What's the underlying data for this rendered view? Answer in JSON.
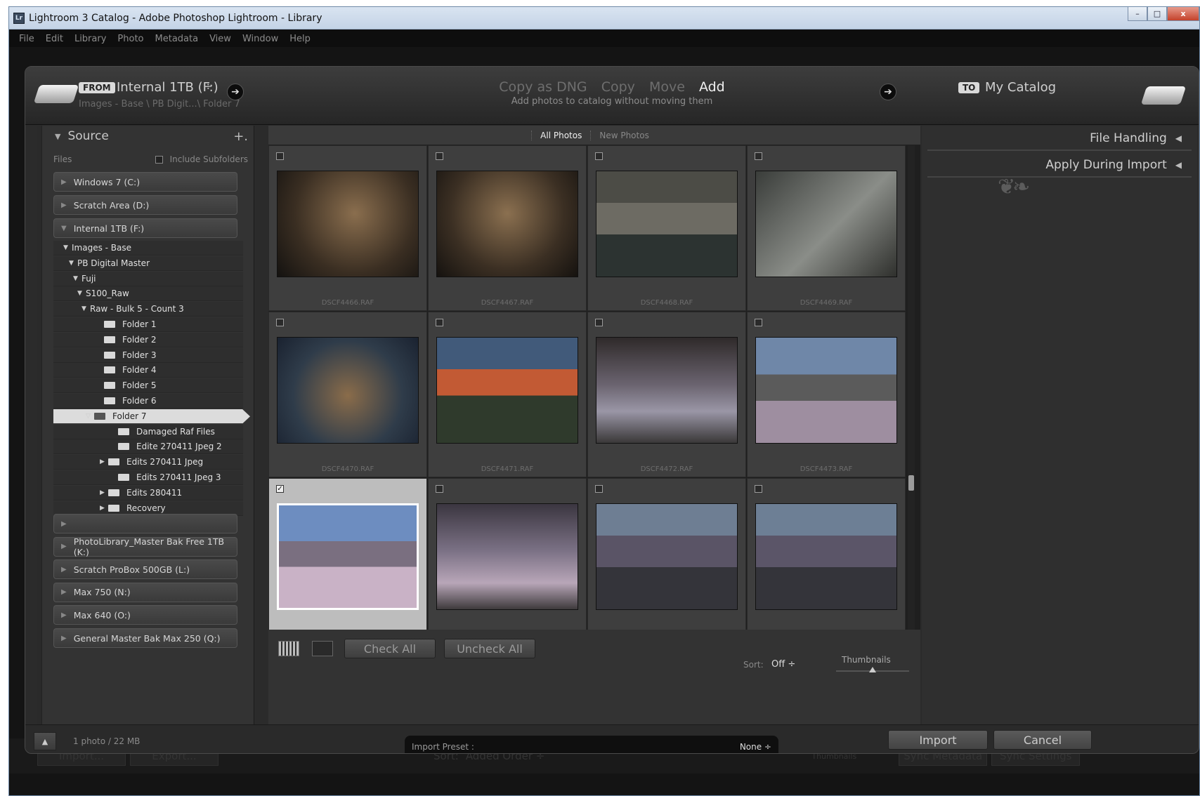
{
  "window": {
    "title": "Lightroom 3 Catalog - Adobe Photoshop Lightroom - Library",
    "app_icon": "Lr",
    "controls": {
      "minimize": "–",
      "maximize": "□",
      "close": "x"
    }
  },
  "menubar": [
    "File",
    "Edit",
    "Library",
    "Photo",
    "Metadata",
    "View",
    "Window",
    "Help"
  ],
  "header": {
    "from_badge": "FROM",
    "source_name": "Internal 1TB (F:)",
    "source_dropdown": "÷",
    "source_path": "Images - Base \\ PB Digit...\\ Folder 7",
    "modes": [
      "Copy as DNG",
      "Copy",
      "Move",
      "Add"
    ],
    "active_mode": "Add",
    "mode_description": "Add photos to catalog without moving them",
    "to_badge": "TO",
    "destination": "My Catalog",
    "arrow": "➔"
  },
  "source_panel": {
    "title": "Source",
    "add_button": "+.",
    "files_label": "Files",
    "include_subfolders": "Include Subfolders",
    "volumes_top": [
      "Windows 7 (C:)",
      "Scratch Area (D:)",
      "Internal 1TB (F:)"
    ],
    "tree": [
      {
        "label": "Images - Base",
        "tri": "▼"
      },
      {
        "label": "PB Digital Master",
        "tri": "▼"
      },
      {
        "label": "Fuji",
        "tri": "▼"
      },
      {
        "label": "S100_Raw",
        "tri": "▼"
      },
      {
        "label": "Raw - Bulk 5 - Count 3",
        "tri": "▼"
      },
      {
        "label": "Folder 1",
        "tri": ""
      },
      {
        "label": "Folder 2",
        "tri": ""
      },
      {
        "label": "Folder 3",
        "tri": ""
      },
      {
        "label": "Folder 4",
        "tri": ""
      },
      {
        "label": "Folder 5",
        "tri": ""
      },
      {
        "label": "Folder 6",
        "tri": ""
      },
      {
        "label": "Folder 7",
        "tri": "▽"
      },
      {
        "label": "Damaged Raf Files",
        "tri": ""
      },
      {
        "label": "Edite 270411 Jpeg 2",
        "tri": ""
      },
      {
        "label": "Edits 270411 Jpeg",
        "tri": "▶"
      },
      {
        "label": "Edits 270411 Jpeg 3",
        "tri": ""
      },
      {
        "label": "Edits 280411",
        "tri": "▶"
      },
      {
        "label": "Recovery",
        "tri": "▶"
      }
    ],
    "volumes_bottom": [
      "",
      "PhotoLibrary_Master Bak Free 1TB (K:)",
      "Scratch ProBox 500GB (L:)",
      "Max 750 (N:)",
      "Max 640 (O:)",
      "General Master Bak Max 250 (Q:)"
    ]
  },
  "grid": {
    "tabs": [
      "All Photos",
      "New Photos"
    ],
    "active_tab": "All Photos",
    "photos": [
      {
        "file": "DSCF4466.RAF",
        "checked": false
      },
      {
        "file": "DSCF4467.RAF",
        "checked": false
      },
      {
        "file": "DSCF4468.RAF",
        "checked": false
      },
      {
        "file": "DSCF4469.RAF",
        "checked": false
      },
      {
        "file": "DSCF4470.RAF",
        "checked": false
      },
      {
        "file": "DSCF4471.RAF",
        "checked": false
      },
      {
        "file": "DSCF4472.RAF",
        "checked": false
      },
      {
        "file": "DSCF4473.RAF",
        "checked": false
      },
      {
        "file": "",
        "checked": true
      },
      {
        "file": "",
        "checked": false
      },
      {
        "file": "",
        "checked": false
      },
      {
        "file": "",
        "checked": false
      }
    ],
    "check_mark": "✓",
    "check_all": "Check All",
    "uncheck_all": "Uncheck All",
    "sort_label": "Sort:",
    "sort_value": "Off ÷",
    "thumbnails_label": "Thumbnails",
    "thumbnail_size": 0.5
  },
  "right_panel": {
    "sections": [
      "File Handling",
      "Apply During Import"
    ],
    "collapse_arrow": "◀"
  },
  "footer": {
    "up_arrow": "▲",
    "count": "1 photo / 22 MB",
    "import_preset_label": "Import Preset :",
    "import_preset_value": "None ÷",
    "import_button": "Import",
    "cancel_button": "Cancel"
  },
  "background": {
    "buttons": [
      "Import...",
      "Export..."
    ],
    "sort_label": "Sort:",
    "sort_value": "Added Order ÷",
    "thumbnails": "Thumbnails",
    "sync_metadata": "Sync Metadata",
    "sync_settings": "Sync Settings"
  }
}
